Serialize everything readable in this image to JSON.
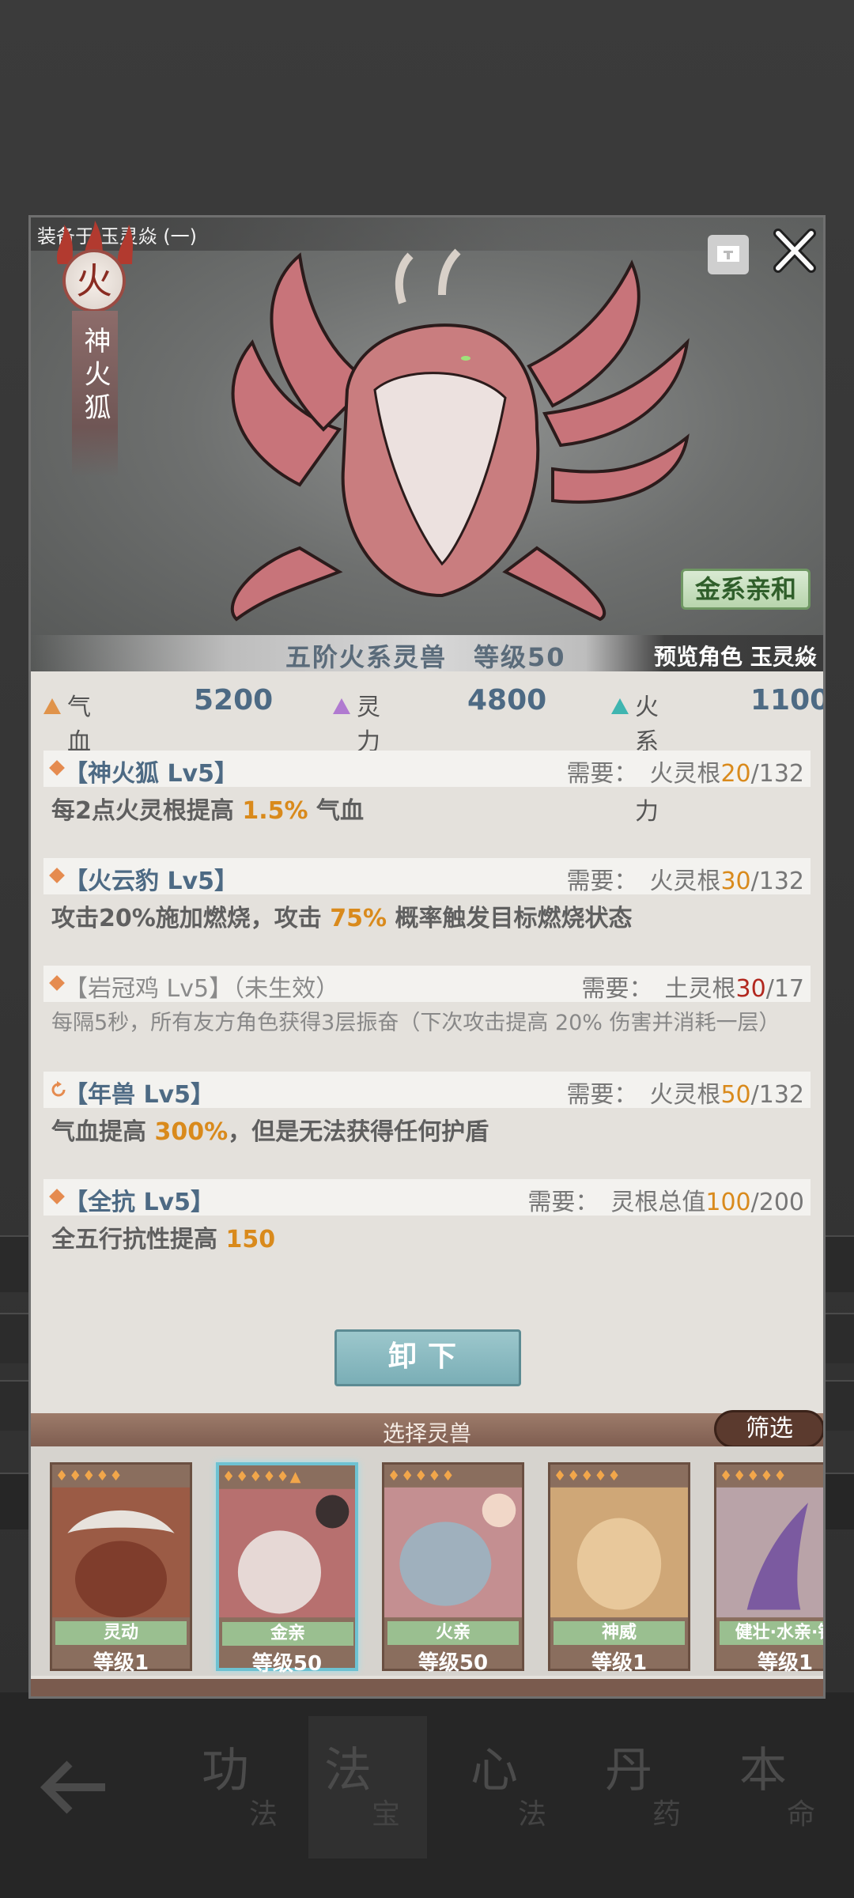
{
  "panel": {
    "equip_label": "装备于 玉灵焱 (一)",
    "element_char": "火",
    "beast_name": "神火狐",
    "affinity": "金系亲和",
    "rank": "五阶火系灵兽　等级50",
    "preview": "预览角色 玉灵焱"
  },
  "stats": [
    {
      "label": "气血",
      "value": "5200",
      "color": "#e0934a"
    },
    {
      "label": "灵力",
      "value": "4800",
      "color": "#b07ad0"
    },
    {
      "label": "火系威力",
      "value": "1100",
      "color": "#3fb5b0"
    }
  ],
  "skills": [
    {
      "name": "【神火狐 Lv5】",
      "req_label": "需要：",
      "req_type": "火灵根",
      "req_cur": "20",
      "req_max": "/132",
      "desc_pre": "每2点火灵根提高 ",
      "desc_hl": "1.5%",
      "desc_post": " 气血"
    },
    {
      "name": "【火云豹 Lv5】",
      "req_label": "需要：",
      "req_type": "火灵根",
      "req_cur": "30",
      "req_max": "/132",
      "desc_pre": "攻击20%施加燃烧，攻击 ",
      "desc_hl": "75%",
      "desc_post": " 概率触发目标燃烧状态"
    },
    {
      "name": "【岩冠鸡 Lv5】（未生效）",
      "req_label": "需要：",
      "req_type": "土灵根",
      "req_cur": "30",
      "req_max": "/17",
      "desc": "每隔5秒，所有友方角色获得3层振奋（下次攻击提高 20% 伤害并消耗一层）"
    },
    {
      "name": "【年兽 Lv5】",
      "req_label": "需要：",
      "req_type": "火灵根",
      "req_cur": "50",
      "req_max": "/132",
      "desc_pre": "气血提高 ",
      "desc_hl": "300%",
      "desc_post": "，但是无法获得任何护盾"
    },
    {
      "name": "【全抗 Lv5】",
      "req_label": "需要：",
      "req_type": "灵根总值",
      "req_cur": "100",
      "req_max": "/200",
      "desc_pre": "全五行抗性提高 ",
      "desc_hl": "150",
      "desc_post": ""
    }
  ],
  "unequip_label": "卸下",
  "select_title": "选择灵兽",
  "filter_label": "筛选",
  "beasts": [
    {
      "tag": "灵动",
      "level": "等级1",
      "stars": "♦♦♦♦♦"
    },
    {
      "tag": "金亲",
      "level": "等级50",
      "stars": "♦♦♦♦♦▲"
    },
    {
      "tag": "火亲",
      "level": "等级50",
      "stars": "♦♦♦♦♦"
    },
    {
      "tag": "神威",
      "level": "等级1",
      "stars": "♦♦♦♦♦"
    },
    {
      "tag": "健壮·水亲·银",
      "level": "等级1",
      "stars": "♦♦♦♦♦"
    }
  ],
  "nav": [
    {
      "big": "功",
      "small": "法"
    },
    {
      "big": "法",
      "small": "宝"
    },
    {
      "big": "心",
      "small": "法"
    },
    {
      "big": "丹",
      "small": "药"
    },
    {
      "big": "本",
      "small": "命"
    }
  ]
}
